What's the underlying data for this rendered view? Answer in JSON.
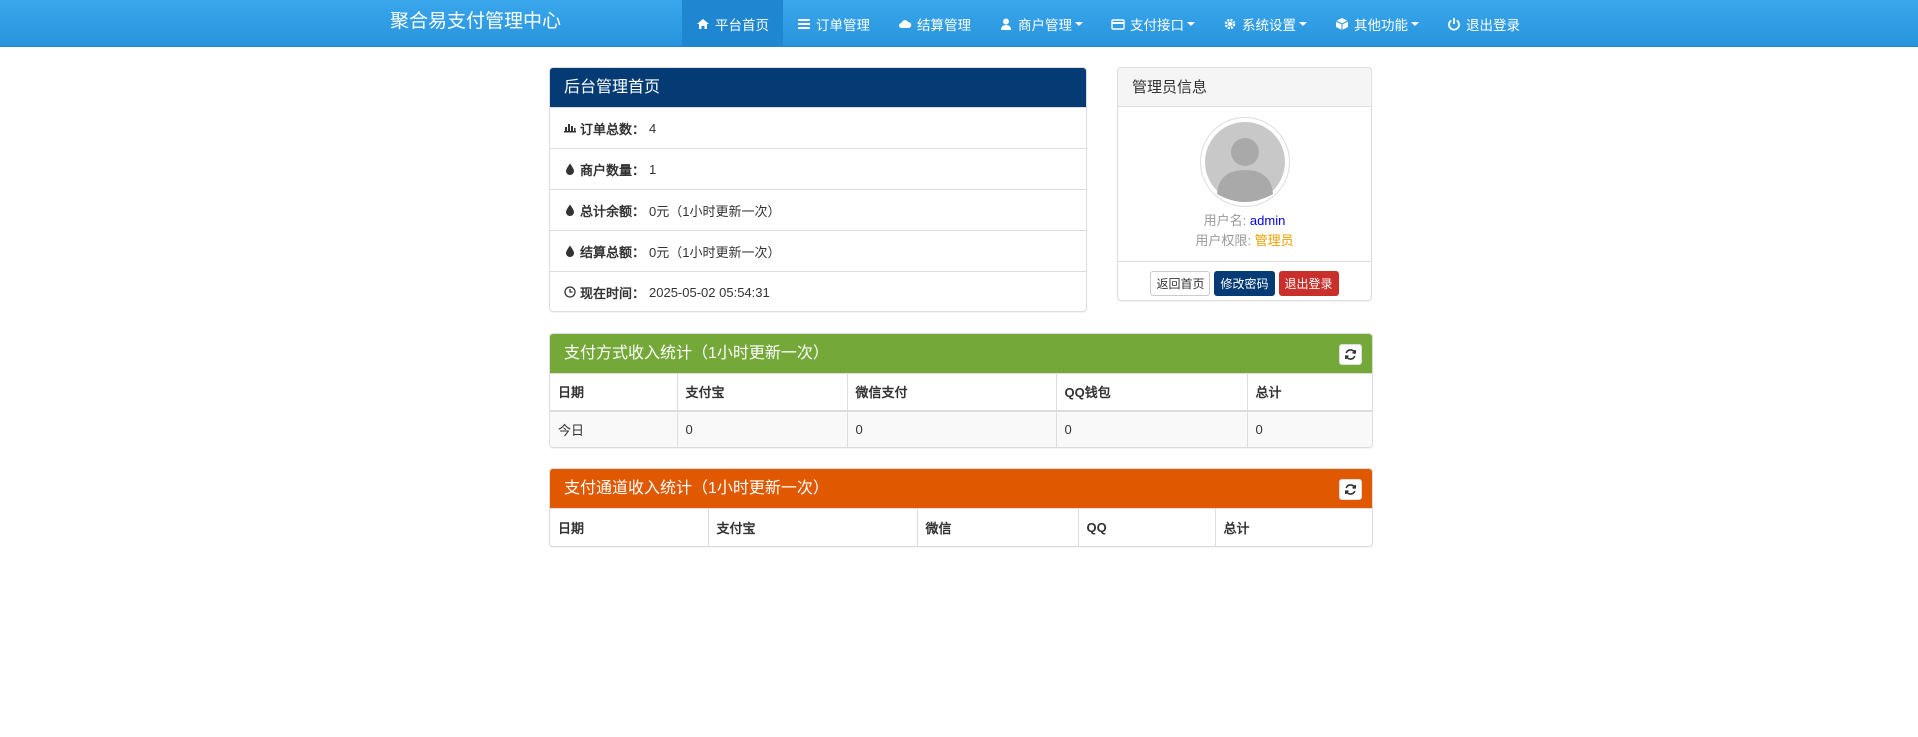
{
  "brand": "聚合易支付管理中心",
  "nav": [
    {
      "label": "平台首页",
      "icon": "home-icon",
      "active": true,
      "dropdown": false
    },
    {
      "label": "订单管理",
      "icon": "list-icon",
      "active": false,
      "dropdown": false
    },
    {
      "label": "结算管理",
      "icon": "cloud-icon",
      "active": false,
      "dropdown": false
    },
    {
      "label": "商户管理",
      "icon": "user-icon",
      "active": false,
      "dropdown": true
    },
    {
      "label": "支付接口",
      "icon": "credit-card-icon",
      "active": false,
      "dropdown": true
    },
    {
      "label": "系统设置",
      "icon": "gear-icon",
      "active": false,
      "dropdown": true
    },
    {
      "label": "其他功能",
      "icon": "cube-icon",
      "active": false,
      "dropdown": true
    },
    {
      "label": "退出登录",
      "icon": "power-icon",
      "active": false,
      "dropdown": false
    }
  ],
  "overview": {
    "title": "后台管理首页",
    "rows": [
      {
        "icon": "bar-chart-icon",
        "label": "订单总数：",
        "value": "4"
      },
      {
        "icon": "drop-icon",
        "label": "商户数量：",
        "value": "1"
      },
      {
        "icon": "drop-icon",
        "label": "总计余额：",
        "value": "0元（1小时更新一次）"
      },
      {
        "icon": "drop-icon",
        "label": "结算总额：",
        "value": "0元（1小时更新一次）"
      },
      {
        "icon": "clock-icon",
        "label": "现在时间：",
        "value": " 2025-05-02 05:54:31"
      }
    ]
  },
  "admin": {
    "title": "管理员信息",
    "username_label": "用户名:",
    "username": "admin",
    "role_label": "用户权限:",
    "role": "管理员",
    "btn_home": "返回首页",
    "btn_password": "修改密码",
    "btn_logout": "退出登录"
  },
  "payment_stats": {
    "title": "支付方式收入统计（1小时更新一次）",
    "headers": [
      "日期",
      "支付宝",
      "微信支付",
      "QQ钱包",
      "总计"
    ],
    "rows": [
      [
        "今日",
        "0",
        "0",
        "0",
        "0"
      ]
    ]
  },
  "channel_stats": {
    "title": "支付通道收入统计（1小时更新一次）",
    "headers": [
      "日期",
      "支付宝",
      "微信",
      "QQ",
      "总计"
    ]
  },
  "colors": {
    "nav": "#2794dd",
    "panel_blue": "#043b74",
    "panel_green": "#74a838",
    "panel_orange": "#e05800",
    "link_blue": "#0000ee",
    "role_orange": "#f0a000"
  }
}
